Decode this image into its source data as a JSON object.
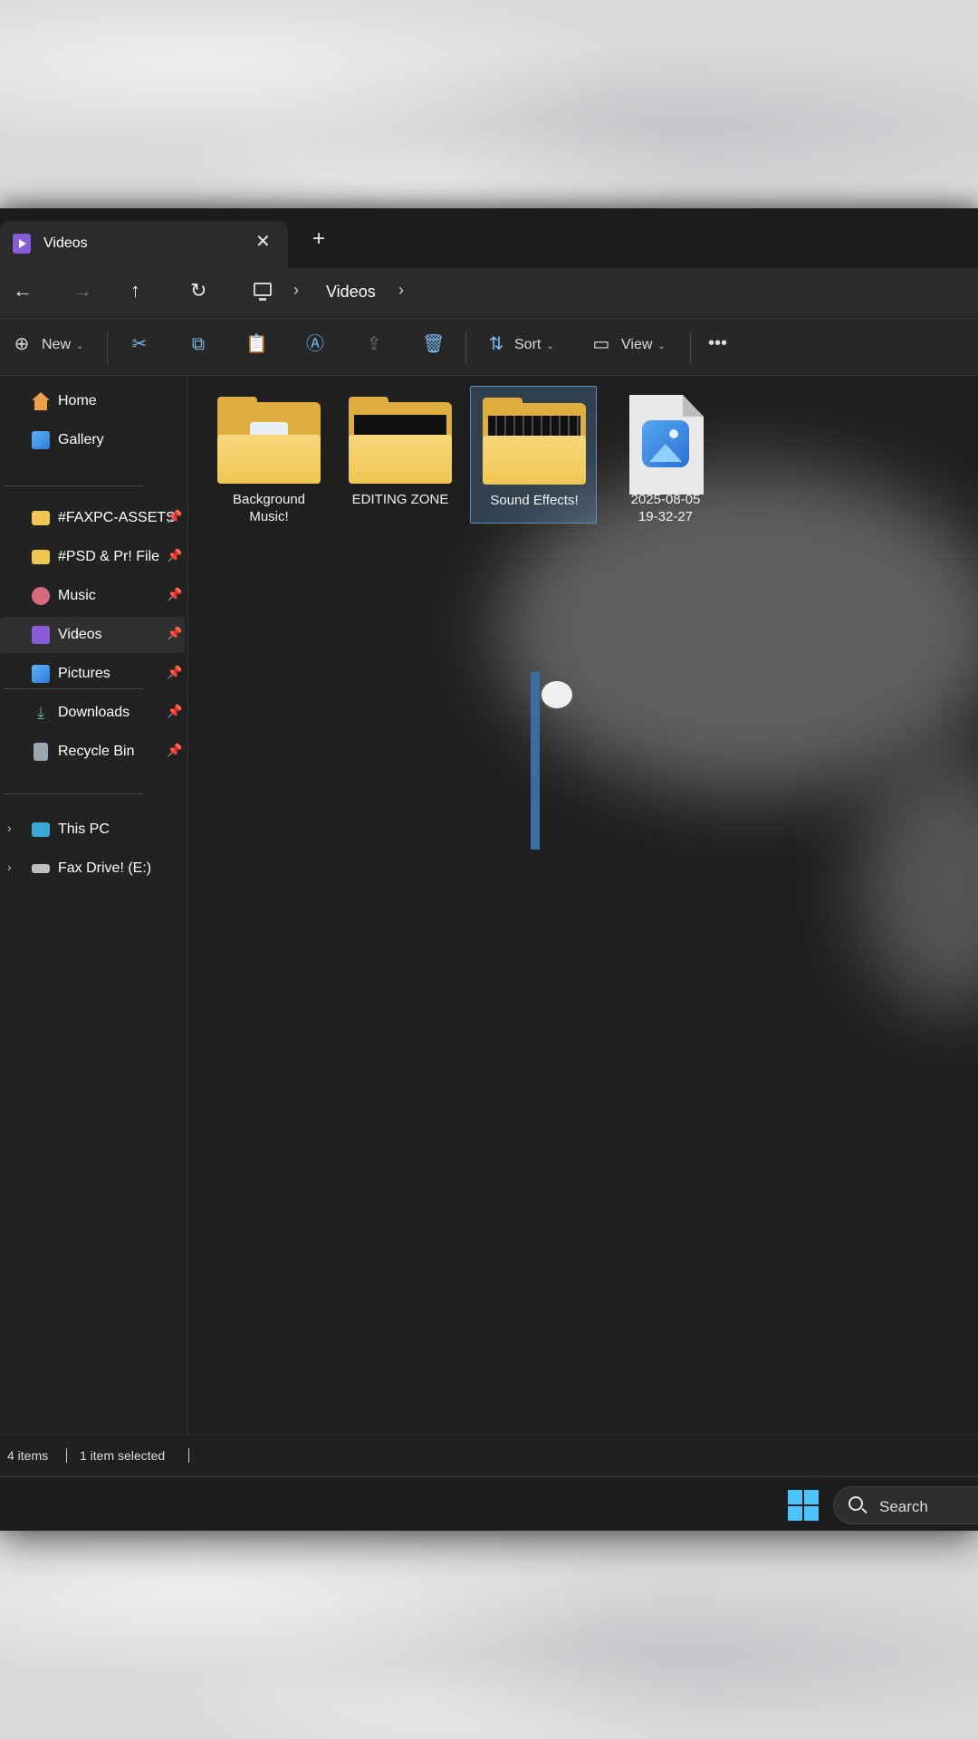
{
  "tab": {
    "title": "Videos"
  },
  "address": {
    "path": [
      "Videos"
    ]
  },
  "toolbar": {
    "new_label": "New",
    "sort_label": "Sort",
    "view_label": "View"
  },
  "sidebar": {
    "items": [
      {
        "label": "Home",
        "icon": "home-icon",
        "pinned": false
      },
      {
        "label": "Gallery",
        "icon": "gallery-icon",
        "pinned": false
      },
      {
        "label": "#FAXPC-ASSETS",
        "icon": "folder-icon",
        "pinned": true
      },
      {
        "label": "#PSD & Pr! File",
        "icon": "folder-icon",
        "pinned": true
      },
      {
        "label": "Music",
        "icon": "music-icon",
        "pinned": true
      },
      {
        "label": "Videos",
        "icon": "videos-icon",
        "pinned": true,
        "active": true
      },
      {
        "label": "Pictures",
        "icon": "pictures-icon",
        "pinned": true
      },
      {
        "label": "Downloads",
        "icon": "downloads-icon",
        "pinned": true
      },
      {
        "label": "Recycle Bin",
        "icon": "recycle-bin-icon",
        "pinned": true
      },
      {
        "label": "This PC",
        "icon": "this-pc-icon",
        "expandable": true
      },
      {
        "label": "Fax Drive! (E:)",
        "icon": "drive-icon",
        "expandable": true
      }
    ]
  },
  "files": [
    {
      "name_line1": "Background",
      "name_line2": "Music!",
      "type": "folder"
    },
    {
      "name_line1": "EDITING ZONE",
      "name_line2": "",
      "type": "folder"
    },
    {
      "name_line1": "Sound Effects!",
      "name_line2": "",
      "type": "folder",
      "selected": true
    },
    {
      "name_line1": "2025-08-05",
      "name_line2": "19-32-27",
      "type": "image"
    }
  ],
  "status": {
    "count": "4 items",
    "selection": "1 item selected"
  },
  "taskbar": {
    "search_label": "Search"
  },
  "colors": {
    "accent": "#4cc2ff",
    "folder": "#f0c653",
    "selection": "#5a90c0"
  }
}
